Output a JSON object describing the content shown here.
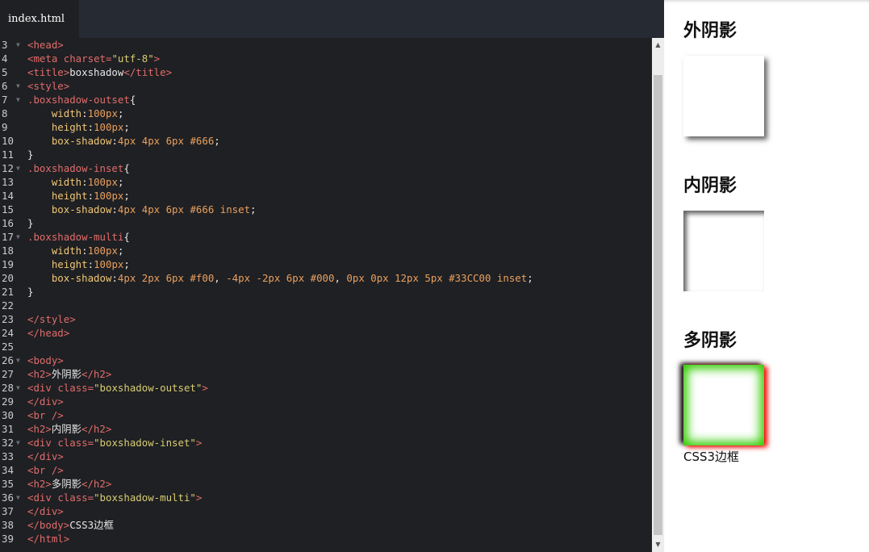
{
  "editor": {
    "tab_label": "index.html",
    "line_numbers": [
      "3",
      "4",
      "5",
      "6",
      "7",
      "8",
      "9",
      "10",
      "11",
      "12",
      "13",
      "14",
      "15",
      "16",
      "17",
      "18",
      "19",
      "20",
      "21",
      "22",
      "23",
      "24",
      "25",
      "26",
      "27",
      "28",
      "29",
      "30",
      "31",
      "32",
      "33",
      "34",
      "35",
      "36",
      "37",
      "38",
      "39"
    ],
    "lines": [
      [
        {
          "t": "<head>",
          "c": "tag"
        }
      ],
      [
        {
          "t": "<meta ",
          "c": "tag"
        },
        {
          "t": "charset=",
          "c": "attr"
        },
        {
          "t": "\"utf-8\"",
          "c": "str"
        },
        {
          "t": ">",
          "c": "tag"
        }
      ],
      [
        {
          "t": "<title>",
          "c": "tag"
        },
        {
          "t": "boxshadow",
          "c": "txt"
        },
        {
          "t": "</title>",
          "c": "tag"
        }
      ],
      [
        {
          "t": "<style>",
          "c": "tag"
        }
      ],
      [
        {
          "t": ".boxshadow-outset",
          "c": "sel"
        },
        {
          "t": "{",
          "c": "txt"
        }
      ],
      [
        {
          "t": "    ",
          "c": "txt"
        },
        {
          "t": "width",
          "c": "prop"
        },
        {
          "t": ":",
          "c": "txt"
        },
        {
          "t": "100px",
          "c": "num"
        },
        {
          "t": ";",
          "c": "txt"
        }
      ],
      [
        {
          "t": "    ",
          "c": "txt"
        },
        {
          "t": "height",
          "c": "prop"
        },
        {
          "t": ":",
          "c": "txt"
        },
        {
          "t": "100px",
          "c": "num"
        },
        {
          "t": ";",
          "c": "txt"
        }
      ],
      [
        {
          "t": "    ",
          "c": "txt"
        },
        {
          "t": "box-shadow",
          "c": "prop"
        },
        {
          "t": ":",
          "c": "txt"
        },
        {
          "t": "4px 4px 6px #666",
          "c": "num"
        },
        {
          "t": ";",
          "c": "txt"
        }
      ],
      [
        {
          "t": "}",
          "c": "txt"
        }
      ],
      [
        {
          "t": ".boxshadow-inset",
          "c": "sel"
        },
        {
          "t": "{",
          "c": "txt"
        }
      ],
      [
        {
          "t": "    ",
          "c": "txt"
        },
        {
          "t": "width",
          "c": "prop"
        },
        {
          "t": ":",
          "c": "txt"
        },
        {
          "t": "100px",
          "c": "num"
        },
        {
          "t": ";",
          "c": "txt"
        }
      ],
      [
        {
          "t": "    ",
          "c": "txt"
        },
        {
          "t": "height",
          "c": "prop"
        },
        {
          "t": ":",
          "c": "txt"
        },
        {
          "t": "100px",
          "c": "num"
        },
        {
          "t": ";",
          "c": "txt"
        }
      ],
      [
        {
          "t": "    ",
          "c": "txt"
        },
        {
          "t": "box-shadow",
          "c": "prop"
        },
        {
          "t": ":",
          "c": "txt"
        },
        {
          "t": "4px 4px 6px #666 inset",
          "c": "num"
        },
        {
          "t": ";",
          "c": "txt"
        }
      ],
      [
        {
          "t": "}",
          "c": "txt"
        }
      ],
      [
        {
          "t": ".boxshadow-multi",
          "c": "sel"
        },
        {
          "t": "{",
          "c": "txt"
        }
      ],
      [
        {
          "t": "    ",
          "c": "txt"
        },
        {
          "t": "width",
          "c": "prop"
        },
        {
          "t": ":",
          "c": "txt"
        },
        {
          "t": "100px",
          "c": "num"
        },
        {
          "t": ";",
          "c": "txt"
        }
      ],
      [
        {
          "t": "    ",
          "c": "txt"
        },
        {
          "t": "height",
          "c": "prop"
        },
        {
          "t": ":",
          "c": "txt"
        },
        {
          "t": "100px",
          "c": "num"
        },
        {
          "t": ";",
          "c": "txt"
        }
      ],
      [
        {
          "t": "    ",
          "c": "txt"
        },
        {
          "t": "box-shadow",
          "c": "prop"
        },
        {
          "t": ":",
          "c": "txt"
        },
        {
          "t": "4px 2px 6px #f00",
          "c": "num"
        },
        {
          "t": ", ",
          "c": "txt"
        },
        {
          "t": "-4px -2px 6px #000",
          "c": "num"
        },
        {
          "t": ", ",
          "c": "txt"
        },
        {
          "t": "0px 0px 12px 5px #33CC00 inset",
          "c": "num"
        },
        {
          "t": ";",
          "c": "txt"
        }
      ],
      [
        {
          "t": "}",
          "c": "txt"
        }
      ],
      [
        {
          "t": "",
          "c": "txt"
        }
      ],
      [
        {
          "t": "</style>",
          "c": "tag"
        }
      ],
      [
        {
          "t": "</head>",
          "c": "tag"
        }
      ],
      [
        {
          "t": "",
          "c": "txt"
        }
      ],
      [
        {
          "t": "<body>",
          "c": "tag"
        }
      ],
      [
        {
          "t": "<h2>",
          "c": "tag"
        },
        {
          "t": "外阴影",
          "c": "txt"
        },
        {
          "t": "</h2>",
          "c": "tag"
        }
      ],
      [
        {
          "t": "<div ",
          "c": "tag"
        },
        {
          "t": "class=",
          "c": "attr"
        },
        {
          "t": "\"boxshadow-outset\"",
          "c": "str"
        },
        {
          "t": ">",
          "c": "tag"
        }
      ],
      [
        {
          "t": "</div>",
          "c": "tag"
        }
      ],
      [
        {
          "t": "<br />",
          "c": "tag"
        }
      ],
      [
        {
          "t": "<h2>",
          "c": "tag"
        },
        {
          "t": "内阴影",
          "c": "txt"
        },
        {
          "t": "</h2>",
          "c": "tag"
        }
      ],
      [
        {
          "t": "<div ",
          "c": "tag"
        },
        {
          "t": "class=",
          "c": "attr"
        },
        {
          "t": "\"boxshadow-inset\"",
          "c": "str"
        },
        {
          "t": ">",
          "c": "tag"
        }
      ],
      [
        {
          "t": "</div>",
          "c": "tag"
        }
      ],
      [
        {
          "t": "<br />",
          "c": "tag"
        }
      ],
      [
        {
          "t": "<h2>",
          "c": "tag"
        },
        {
          "t": "多阴影",
          "c": "txt"
        },
        {
          "t": "</h2>",
          "c": "tag"
        }
      ],
      [
        {
          "t": "<div ",
          "c": "tag"
        },
        {
          "t": "class=",
          "c": "attr"
        },
        {
          "t": "\"boxshadow-multi\"",
          "c": "str"
        },
        {
          "t": ">",
          "c": "tag"
        }
      ],
      [
        {
          "t": "</div>",
          "c": "tag"
        }
      ],
      [
        {
          "t": "</body>",
          "c": "tag"
        },
        {
          "t": "CSS3边框",
          "c": "txt"
        }
      ],
      [
        {
          "t": "</html>",
          "c": "tag"
        }
      ]
    ],
    "foldable": [
      "3",
      "6",
      "7",
      "12",
      "17",
      "26",
      "28",
      "32",
      "36"
    ]
  },
  "preview": {
    "heading_outset": "外阴影",
    "heading_inset": "内阴影",
    "heading_multi": "多阴影",
    "footer_text": "CSS3边框"
  },
  "scrollbar": {
    "up_icon": "▲",
    "down_icon": "▼"
  }
}
